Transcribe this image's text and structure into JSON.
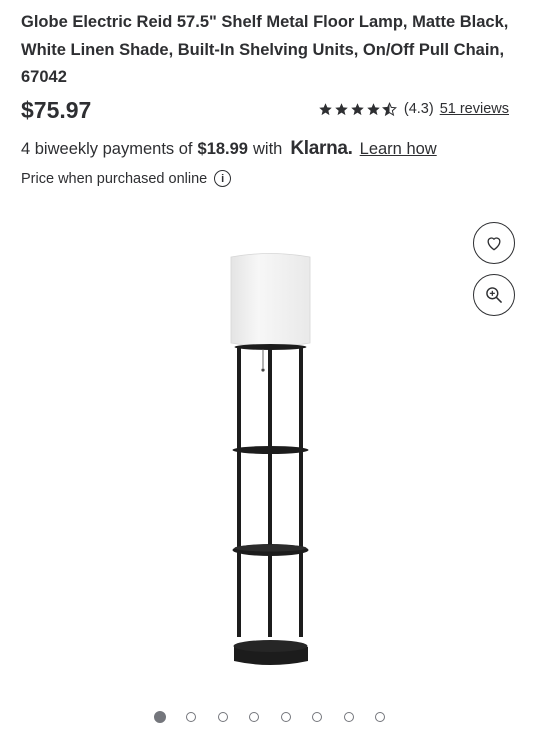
{
  "product": {
    "title": "Globe Electric Reid 57.5\" Shelf Metal Floor Lamp, Matte Black, White Linen Shade, Built-In Shelving Units, On/Off Pull Chain, 67042",
    "price": "$75.97",
    "rating_value": "(4.3)",
    "rating_stars": 4.3,
    "reviews_link": "51 reviews"
  },
  "payments": {
    "prefix": "4 biweekly payments of",
    "amount": "$18.99",
    "with": "with",
    "provider": "Klarna.",
    "learn_link": "Learn how"
  },
  "price_note": "Price when purchased online",
  "info_icon": "i",
  "gallery": {
    "image_count": 8,
    "active_index": 0,
    "buttons": [
      "heart-icon",
      "zoom-in-icon"
    ]
  }
}
